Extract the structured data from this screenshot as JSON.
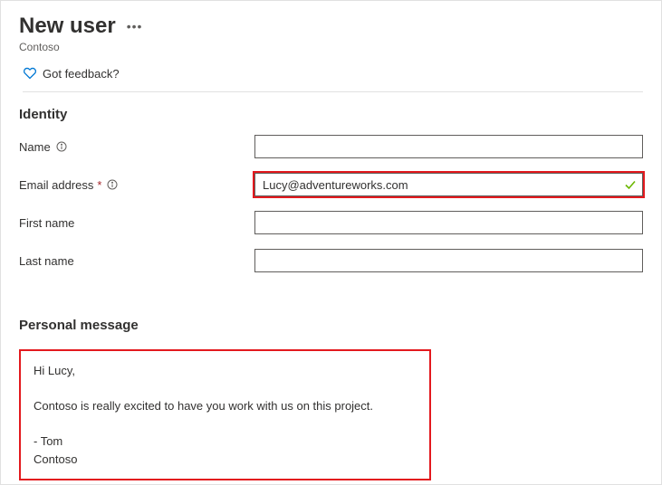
{
  "header": {
    "title": "New user",
    "subtitle": "Contoso",
    "feedbackLabel": "Got feedback?"
  },
  "identity": {
    "heading": "Identity",
    "nameLabel": "Name",
    "nameValue": "",
    "emailLabel": "Email address",
    "emailValue": "Lucy@adventureworks.com",
    "firstNameLabel": "First name",
    "firstNameValue": "",
    "lastNameLabel": "Last name",
    "lastNameValue": ""
  },
  "personalMessage": {
    "heading": "Personal message",
    "body": "Hi Lucy,\n\nContoso is really excited to have you work with us on this project.\n\n- Tom\nContoso"
  }
}
